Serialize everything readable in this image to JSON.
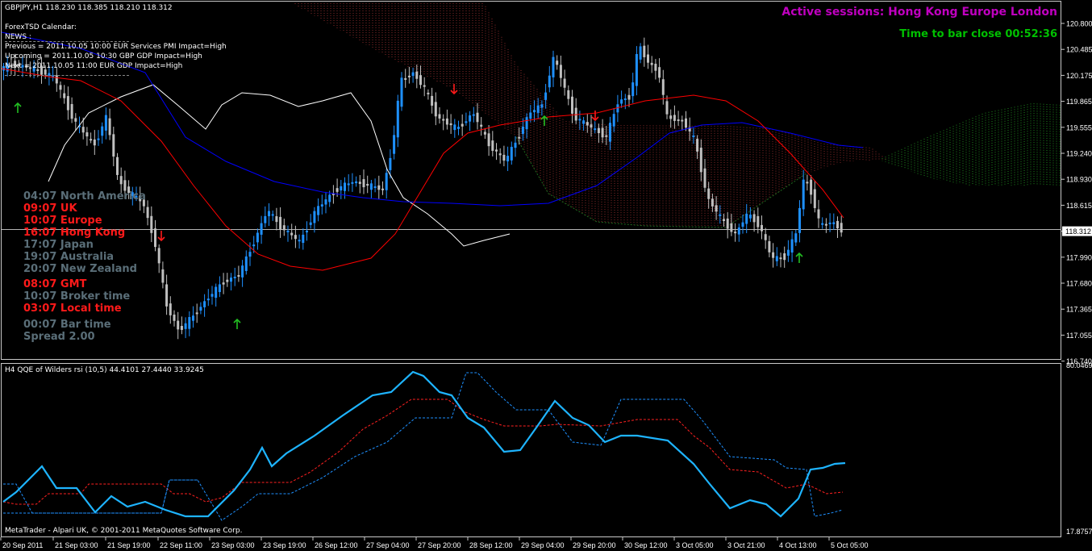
{
  "main_header": "GBPJPY,H1  118.230 118.385 118.210 118.312",
  "calendar": {
    "title": "ForexTSD Calendar:",
    "news": "NEWS :",
    "previous": "Previous = 2011.10.05 10:00 EUR Services PMI  Impact=High",
    "upcoming": "Upcoming = 2011.10.05 10:30 GBP GDP Impact=High",
    "next": "Next = 2011.10.05 11:00 EUR GDP Impact=High"
  },
  "active_sessions": "Active sessions:  Hong Kong Europe London",
  "time_to_close": "Time to bar close 00:52:36",
  "sessions": [
    {
      "text": "04:07 North America",
      "color": "#5a6e78"
    },
    {
      "text": "09:07 UK",
      "color": "#ff1a1a"
    },
    {
      "text": "10:07 Europe",
      "color": "#ff1a1a"
    },
    {
      "text": "16:07 Hong Kong",
      "color": "#ff1a1a"
    },
    {
      "text": "17:07 Japan",
      "color": "#5a6e78"
    },
    {
      "text": "19:07 Australia",
      "color": "#5a6e78"
    },
    {
      "text": "20:07 New Zealand",
      "color": "#5a6e78"
    },
    {
      "text": "08:07 GMT",
      "color": "#ff1a1a"
    },
    {
      "text": "10:07 Broker time",
      "color": "#5a6e78"
    },
    {
      "text": "03:07 Local time",
      "color": "#ff1a1a"
    },
    {
      "text": "00:07 Bar time",
      "color": "#5a6e78"
    },
    {
      "text": "Spread     2.00",
      "color": "#5a6e78"
    }
  ],
  "price_axis": [
    "120.800",
    "120.485",
    "120.175",
    "119.865",
    "119.555",
    "119.240",
    "118.930",
    "118.615",
    "118.312",
    "117.990",
    "117.680",
    "117.365",
    "117.055",
    "116.740"
  ],
  "current_price": "118.312",
  "indicator_header": "H4 QQE of Wilders rsi (10,5) 44.4101 27.4440 33.9245",
  "indicator_axis": [
    "80.0469",
    "17.8757"
  ],
  "copyright": "MetaTrader - Alpari UK, © 2001-2011 MetaQuotes Software Corp.",
  "time_axis": [
    "20 Sep 2011",
    "21 Sep 03:00",
    "21 Sep 19:00",
    "22 Sep 11:00",
    "23 Sep 03:00",
    "23 Sep 19:00",
    "26 Sep 12:00",
    "27 Sep 04:00",
    "27 Sep 20:00",
    "28 Sep 12:00",
    "29 Sep 04:00",
    "29 Sep 20:00",
    "30 Sep 12:00",
    "3 Oct 05:00",
    "3 Oct 21:00",
    "4 Oct 13:00",
    "5 Oct 05:00"
  ],
  "colors": {
    "up_candle": "#1e90ff",
    "down_candle": "#c0c0c0",
    "ma_fast": "#ff0000",
    "ma_slow": "#0000ff",
    "envelope": "#ffffff",
    "qqe_line": "#1eb4ff",
    "qqe_red": "#ff2020",
    "qqe_blue": "#1e90ff",
    "sessions_title": "#c000c0",
    "bar_close": "#00c000"
  }
}
